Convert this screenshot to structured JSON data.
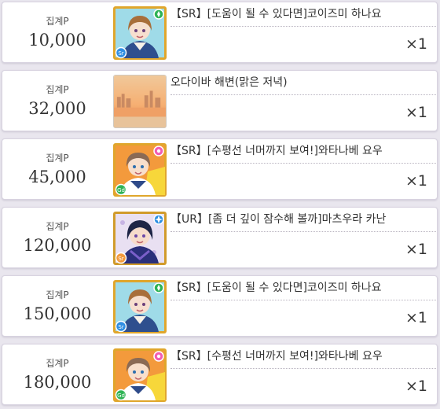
{
  "rewards": [
    {
      "points_label": "집계P",
      "points": "10,000",
      "name": "【SR】[도움이 될 수 있다면]코이즈미 하나요",
      "quantity": "×1",
      "icon": "card-icon-hanayo",
      "type": "card",
      "attribute": "smile-icon"
    },
    {
      "points_label": "집계P",
      "points": "32,000",
      "name": "오다이바 해변(맑은 저녁)",
      "quantity": "×1",
      "icon": "background-icon-odaiba",
      "type": "background"
    },
    {
      "points_label": "집계P",
      "points": "45,000",
      "name": "【SR】[수평선 너머까지 보여!]와타나베 요우",
      "quantity": "×1",
      "icon": "card-icon-you",
      "type": "card",
      "attribute": "pure-icon"
    },
    {
      "points_label": "집계P",
      "points": "120,000",
      "name": "【UR】[좀 더 깊이 잠수해 볼까]마츠우라 카난",
      "quantity": "×1",
      "icon": "card-icon-kanan",
      "type": "card",
      "attribute": "cool-icon"
    },
    {
      "points_label": "집계P",
      "points": "150,000",
      "name": "【SR】[도움이 될 수 있다면]코이즈미 하나요",
      "quantity": "×1",
      "icon": "card-icon-hanayo",
      "type": "card",
      "attribute": "smile-icon"
    },
    {
      "points_label": "집계P",
      "points": "180,000",
      "name": "【SR】[수평선 너머까지 보여!]와타나베 요우",
      "quantity": "×1",
      "icon": "card-icon-you",
      "type": "card",
      "attribute": "pure-icon"
    }
  ],
  "colors": {
    "page_bg": "#e9e6ee",
    "frame_gold": "#e0a62c",
    "smile_badge": "#f25db4",
    "pure_badge": "#2fb356",
    "cool_badge": "#2f8fe3",
    "sr_badge": "#8f9db3",
    "ur_badge": "#d19b2b"
  }
}
